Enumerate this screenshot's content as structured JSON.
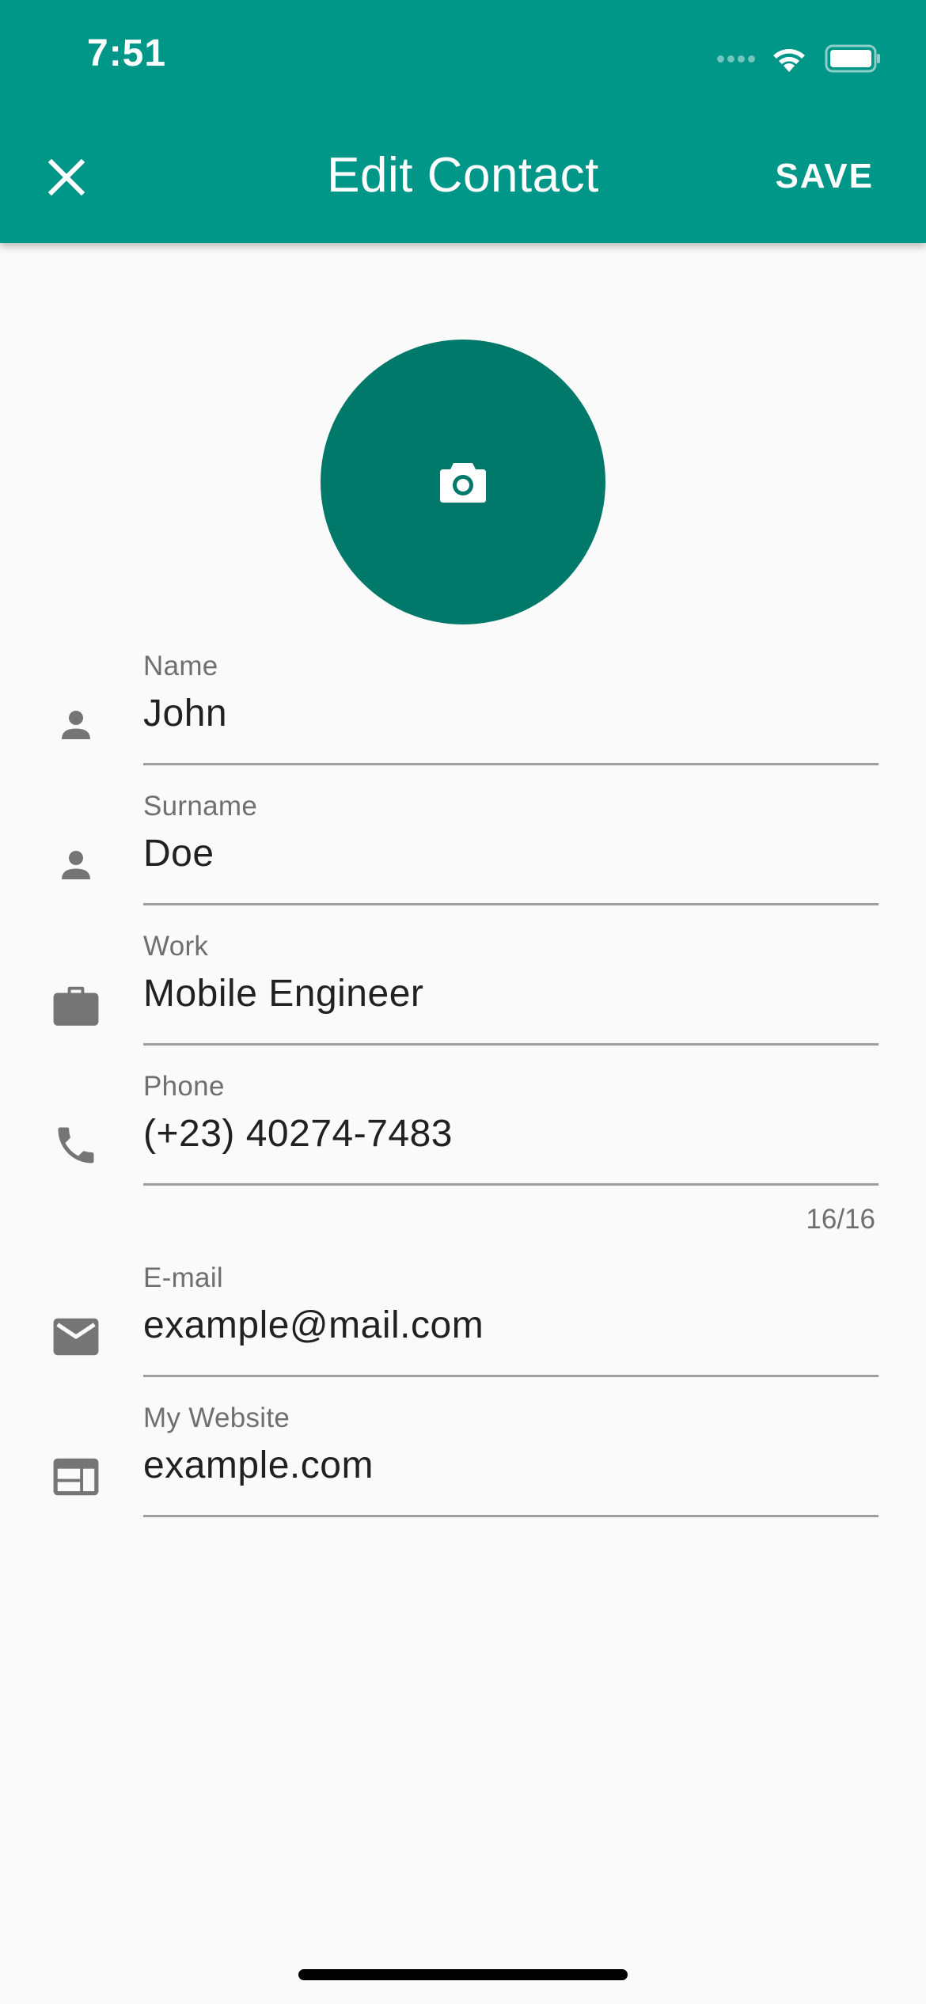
{
  "status_bar": {
    "time": "7:51",
    "icons": [
      "cellular-signal-icon",
      "wifi-icon",
      "battery-icon"
    ]
  },
  "app_bar": {
    "close_icon": "close-icon",
    "title": "Edit Contact",
    "save_label": "SAVE",
    "background_color": "#009688"
  },
  "avatar": {
    "icon": "camera-icon",
    "background_color": "#00796b"
  },
  "fields": [
    {
      "id": "name",
      "label": "Name",
      "value": "John",
      "icon": "person-icon"
    },
    {
      "id": "surname",
      "label": "Surname",
      "value": "Doe",
      "icon": "person-icon"
    },
    {
      "id": "work",
      "label": "Work",
      "value": "Mobile Engineer",
      "icon": "briefcase-icon"
    },
    {
      "id": "phone",
      "label": "Phone",
      "value": "(+23) 40274-7483",
      "icon": "phone-icon",
      "counter": "16/16"
    },
    {
      "id": "email",
      "label": "E-mail",
      "value": "example@mail.com",
      "icon": "email-icon"
    },
    {
      "id": "website",
      "label": "My Website",
      "value": "example.com",
      "icon": "web-icon"
    }
  ]
}
